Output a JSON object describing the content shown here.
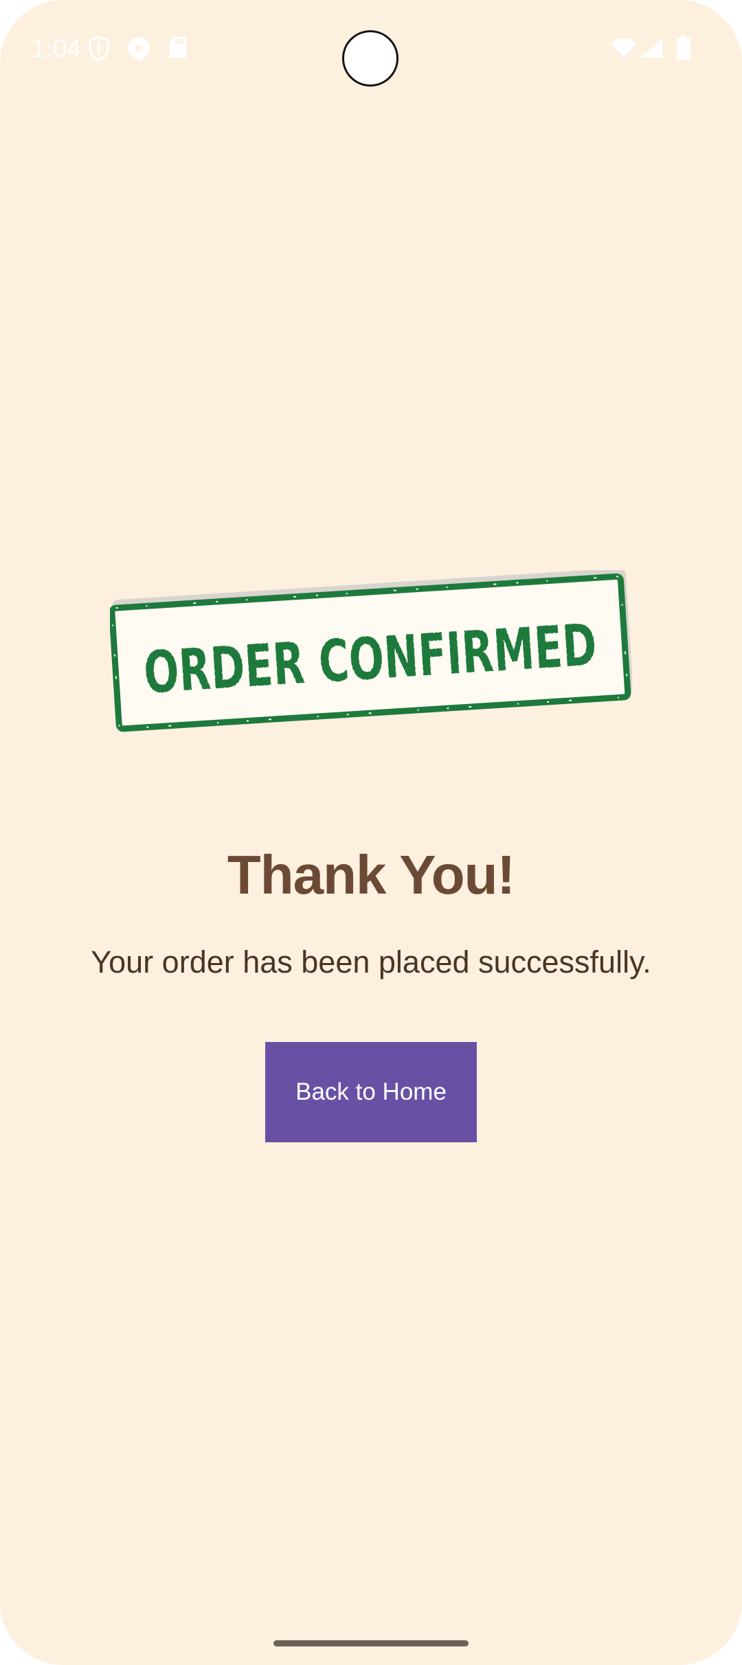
{
  "status_bar": {
    "time": "1:04",
    "left_icons": [
      "shield-icon",
      "play-icon",
      "sd-card-icon"
    ],
    "right_icons": [
      "wifi-icon",
      "signal-icon",
      "battery-icon"
    ]
  },
  "stamp": {
    "text": "ORDER CONFIRMED",
    "color": "#1e7a3c"
  },
  "main": {
    "title": "Thank You!",
    "message": "Your order has been placed successfully.",
    "button_label": "Back to Home"
  },
  "colors": {
    "background": "#fdf0de",
    "title": "#6b4a35",
    "button": "#6851a5"
  }
}
